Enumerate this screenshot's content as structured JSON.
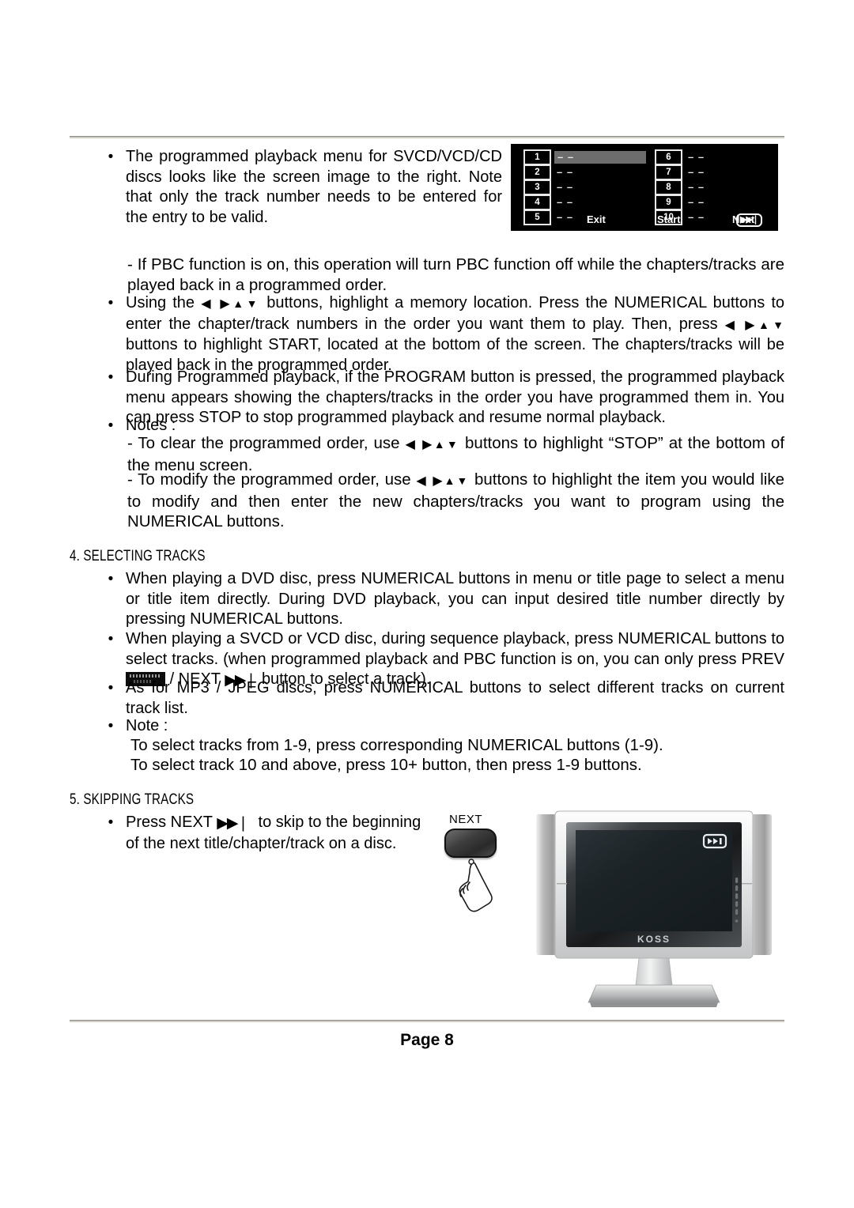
{
  "page": {
    "footer_label": "Page 8"
  },
  "body": {
    "bullet1": "The programmed playback menu for SVCD/VCD/CD discs looks like the screen image to the right. Note that only the track number needs to be entered for the entry to be valid.",
    "note_pbc": "- If PBC function is on, this operation will turn PBC function off while the chapters/tracks are played back in a programmed order.",
    "bullet2_a": "Using the",
    "bullet2_b": "buttons, highlight a memory location. Press the NUMERICAL buttons to enter the chapter/track numbers in the order you want them to play. Then, press",
    "bullet2_c": "buttons to highlight START, located at the bottom of the screen. The chapters/tracks will be played back in the programmed order.",
    "bullet3": "During Programmed playback, if the PROGRAM button is pressed, the programmed playback menu appears showing the chapters/tracks in the order you have programmed them in. You can press STOP to stop programmed playback and resume normal playback.",
    "notes_label": "Notes :",
    "note_clear_a": "- To clear the programmed order, use",
    "note_clear_b": "buttons to highlight “STOP” at the bottom of the menu screen.",
    "note_modify_a": "- To modify the programmed order, use",
    "note_modify_b": "buttons to highlight the item you would like to modify and then enter the new chapters/tracks you want to program using the NUMERICAL buttons.",
    "arrow_left": "◀",
    "arrow_right": "▶",
    "arrow_up": "▲",
    "arrow_down": "▼"
  },
  "section4": {
    "heading": "4. SELECTING TRACKS",
    "bullet1": "When playing a DVD disc, press NUMERICAL buttons in menu or title page to select a menu or title item directly. During DVD playback, you can input desired title number directly by pressing NUMERICAL buttons.",
    "bullet2_a": "When playing a SVCD or VCD disc, during sequence playback, press NUMERICAL buttons to select tracks. (when programmed playback and PBC function is on, you can only press PREV",
    "bullet2_sep": "/ NEXT",
    "bullet2_b": "button to select a track).",
    "bullet3": "As for MP3 / JPEG discs, press NUMERICAL buttons to select different tracks on current track list.",
    "note_label": "Note :",
    "note_line1": "To select tracks from 1-9, press corresponding NUMERICAL buttons (1-9).",
    "note_line2": "To select track 10 and above, press 10+ button, then press 1-9 buttons."
  },
  "section5": {
    "heading": "5. SKIPPING TRACKS",
    "bullet1_a": "Press   NEXT",
    "bullet1_b": "to   skip   to   the beginning of the next title/chapter/track on a disc."
  },
  "program_menu": {
    "left_column": [
      {
        "number": "1",
        "value": "– –",
        "selected": true
      },
      {
        "number": "2",
        "value": "– –",
        "selected": false
      },
      {
        "number": "3",
        "value": "– –",
        "selected": false
      },
      {
        "number": "4",
        "value": "– –",
        "selected": false
      },
      {
        "number": "5",
        "value": "– –",
        "selected": false
      }
    ],
    "right_column": [
      {
        "number": "6",
        "value": "– –",
        "selected": false
      },
      {
        "number": "7",
        "value": "– –",
        "selected": false
      },
      {
        "number": "8",
        "value": "– –",
        "selected": false
      },
      {
        "number": "9",
        "value": "– –",
        "selected": false
      },
      {
        "number": "10",
        "value": "– –",
        "selected": false
      }
    ],
    "exit_label": "Exit",
    "start_label": "Start",
    "next_label": "Next",
    "next_icon": "▶▶❘",
    "background_color": "#000000",
    "highlight_color": "#6d6d6d",
    "text_color": "#e9e9e9"
  },
  "next_button": {
    "label": "NEXT",
    "icon_name": "hand-pointer-icon"
  },
  "tv": {
    "brand": "KOSS",
    "osd_icon": "next-track-osd-icon",
    "screen_color": "#1c2327",
    "bezel_color": "#cfd1d2"
  },
  "icons": {
    "next_glyph": "▶▶",
    "next_bar": "❘"
  }
}
